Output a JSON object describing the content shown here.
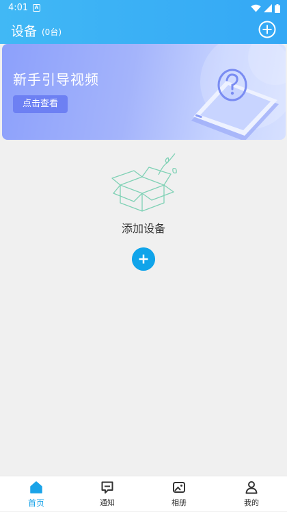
{
  "status_bar": {
    "time": "4:01",
    "app_icon_letter": "A"
  },
  "header": {
    "title": "设备",
    "device_count": "(0台)"
  },
  "banner": {
    "title": "新手引导视频",
    "button_label": "点击查看"
  },
  "empty_state": {
    "label": "添加设备"
  },
  "tabs": [
    {
      "label": "首页",
      "active": true
    },
    {
      "label": "通知",
      "active": false
    },
    {
      "label": "相册",
      "active": false
    },
    {
      "label": "我的",
      "active": false
    }
  ],
  "colors": {
    "header": "#34a8f5",
    "accent": "#10a4ea",
    "banner_button": "#6d80f3",
    "background": "#f0f0f0"
  }
}
